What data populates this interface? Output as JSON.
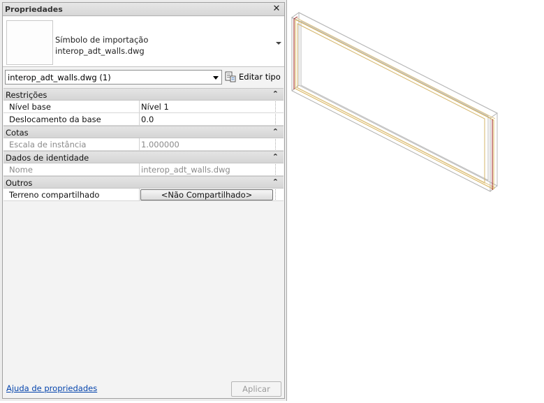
{
  "palette": {
    "title": "Propriedades",
    "close_glyph": "✕",
    "type_selector": {
      "line1": "Símbolo de importação",
      "line2": "interop_adt_walls.dwg"
    },
    "instance_filter": "interop_adt_walls.dwg (1)",
    "edit_type_label": "Editar tipo",
    "sections": [
      {
        "name": "Restrições",
        "rows": [
          {
            "label": "Nível base",
            "value": "Nível 1"
          },
          {
            "label": "Deslocamento da base",
            "value": "0.0"
          }
        ]
      },
      {
        "name": "Cotas",
        "rows": [
          {
            "label": "Escala de instância",
            "value": "1.000000"
          }
        ]
      },
      {
        "name": "Dados de identidade",
        "rows": [
          {
            "label": "Nome",
            "value": "interop_adt_walls.dwg"
          }
        ]
      },
      {
        "name": "Outros",
        "rows": [
          {
            "label": "Terreno compartilhado",
            "value": "<Não Compartilhado>"
          }
        ]
      }
    ],
    "help_link": "Ajuda de propriedades",
    "apply_label": "Aplicar"
  },
  "colors": {
    "wall_outline": "#a8a8a8",
    "wall_highlight": "#d9b45a",
    "wall_accent": "#9a1a1a"
  },
  "icons": {
    "close": "close-icon",
    "dropdown": "chevron-down-icon",
    "edit_type": "edit-type-icon",
    "collapse": "collapse-chevron-icon"
  }
}
